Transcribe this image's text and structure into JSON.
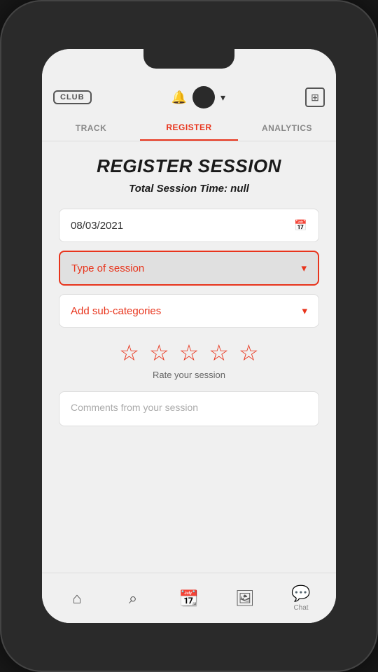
{
  "phone": {
    "topNav": {
      "clubLabel": "CLUB",
      "chevronLabel": "▾",
      "expandLabel": "⊞"
    },
    "tabs": [
      {
        "id": "track",
        "label": "TRACK",
        "active": false
      },
      {
        "id": "register",
        "label": "REGISTER",
        "active": true
      },
      {
        "id": "analytics",
        "label": "ANALYTICS",
        "active": false
      }
    ],
    "page": {
      "title": "REGISTER SESSION",
      "sessionTime": "Total Session Time: null",
      "dateValue": "08/03/2021",
      "datePlaceholder": "08/03/2021",
      "typeOfSessionLabel": "Type of session",
      "subCategoriesLabel": "Add sub-categories",
      "rateLabel": "Rate your session",
      "commentsPlaceholder": "Comments from your session",
      "stars": [
        "☆",
        "☆",
        "☆",
        "☆",
        "☆"
      ]
    },
    "bottomNav": [
      {
        "id": "home",
        "icon": "⌂",
        "label": ""
      },
      {
        "id": "search",
        "icon": "⌕",
        "label": ""
      },
      {
        "id": "calendar",
        "icon": "⊞",
        "label": ""
      },
      {
        "id": "gallery",
        "icon": "▦",
        "label": ""
      },
      {
        "id": "chat",
        "icon": "◉",
        "label": "Chat"
      }
    ]
  }
}
